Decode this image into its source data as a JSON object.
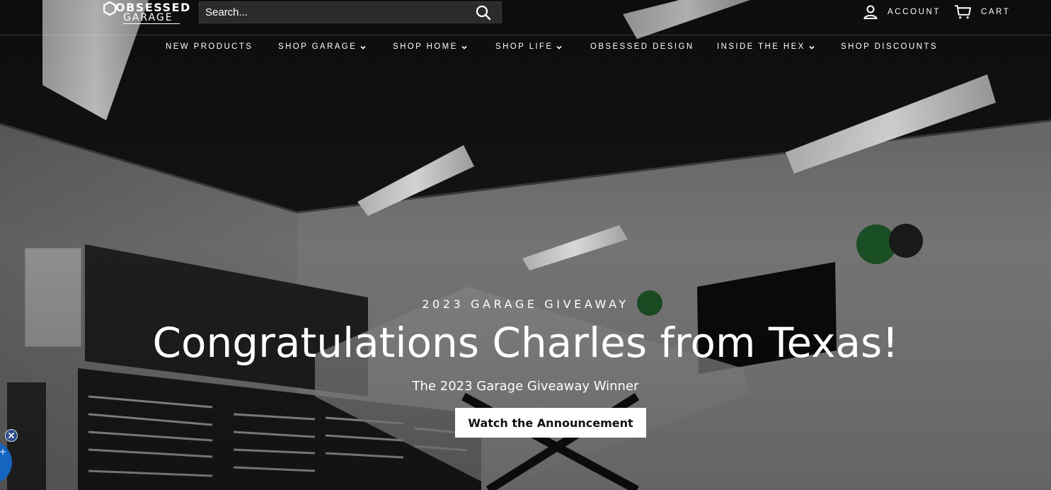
{
  "header": {
    "logo": {
      "line1": "OBSESSED",
      "line2": "GARAGE"
    },
    "search": {
      "placeholder": "Search..."
    },
    "account_label": "ACCOUNT",
    "cart_label": "CART",
    "icons": {
      "search": "search-icon",
      "account": "user-icon",
      "cart": "cart-icon"
    }
  },
  "nav": {
    "items": [
      {
        "label": "NEW PRODUCTS",
        "dropdown": false
      },
      {
        "label": "SHOP GARAGE",
        "dropdown": true
      },
      {
        "label": "SHOP HOME",
        "dropdown": true
      },
      {
        "label": "SHOP LIFE",
        "dropdown": true
      },
      {
        "label": "OBSESSED DESIGN",
        "dropdown": false
      },
      {
        "label": "INSIDE THE HEX",
        "dropdown": true
      },
      {
        "label": "SHOP DISCOUNTS",
        "dropdown": false
      }
    ]
  },
  "hero": {
    "eyebrow": "2023 GARAGE GIVEAWAY",
    "headline": "Congratulations Charles from Texas!",
    "subhead": "The 2023 Garage Giveaway Winner",
    "cta_label": "Watch the Announcement",
    "background": "garage-interior-photo"
  },
  "widgets": {
    "close_icon": "close-icon",
    "chat_icon": "chat-bubble-icon",
    "accent": "#1565c0"
  }
}
